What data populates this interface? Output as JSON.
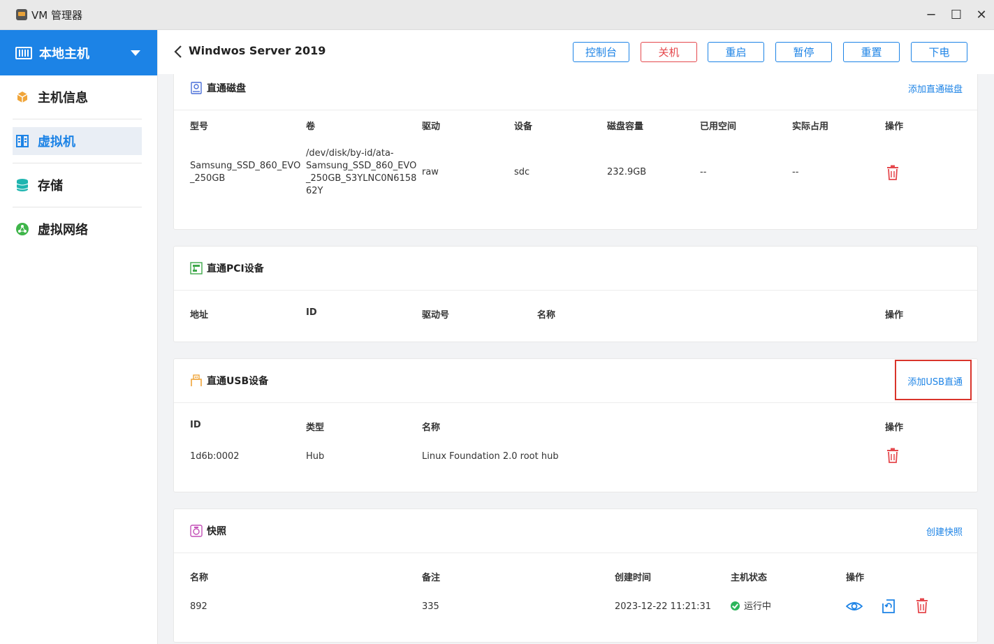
{
  "window": {
    "title": "VM 管理器",
    "controls": {
      "minimize": "─",
      "maximize": "☐",
      "close": "✕"
    }
  },
  "sidebar": {
    "host_label": "本地主机",
    "items": [
      {
        "label": "主机信息",
        "icon": "cube-icon",
        "active": false
      },
      {
        "label": "虚拟机",
        "icon": "vm-icon",
        "active": true
      },
      {
        "label": "存储",
        "icon": "storage-icon",
        "active": false
      },
      {
        "label": "虚拟网络",
        "icon": "network-icon",
        "active": false
      }
    ]
  },
  "header": {
    "title": "Windwos Server 2019",
    "buttons": [
      "控制台",
      "关机",
      "重启",
      "暂停",
      "重置",
      "下电"
    ]
  },
  "passthrough_disk": {
    "title": "直通磁盘",
    "action": "添加直通磁盘",
    "columns": [
      "型号",
      "卷",
      "驱动",
      "设备",
      "磁盘容量",
      "已用空间",
      "实际占用",
      "操作"
    ],
    "rows": [
      {
        "model": "Samsung_SSD_860_EVO\n_250GB",
        "volume": "/dev/disk/by-id/ata-\nSamsung_SSD_860_EVO\n_250GB_S3YLNC0N6158\n62Y",
        "driver": "raw",
        "device": "sdc",
        "capacity": "232.9GB",
        "used": "--",
        "actual": "--"
      }
    ]
  },
  "passthrough_pci": {
    "title": "直通PCI设备",
    "columns": [
      "地址",
      "ID",
      "驱动号",
      "名称",
      "操作"
    ],
    "rows": []
  },
  "passthrough_usb": {
    "title": "直通USB设备",
    "action": "添加USB直通",
    "columns": [
      "ID",
      "类型",
      "名称",
      "操作"
    ],
    "rows": [
      {
        "id": "1d6b:0002",
        "type": "Hub",
        "name": "Linux Foundation 2.0 root hub"
      }
    ]
  },
  "snapshot": {
    "title": "快照",
    "action": "创建快照",
    "columns": [
      "名称",
      "备注",
      "创建时间",
      "主机状态",
      "操作"
    ],
    "rows": [
      {
        "name": "892",
        "note": "335",
        "created": "2023-12-22 11:21:31",
        "status": "运行中"
      }
    ]
  },
  "colors": {
    "accent": "#1c83e6",
    "danger": "#e5484d",
    "highlight_box": "#d9342b",
    "running": "#2cb55b"
  }
}
